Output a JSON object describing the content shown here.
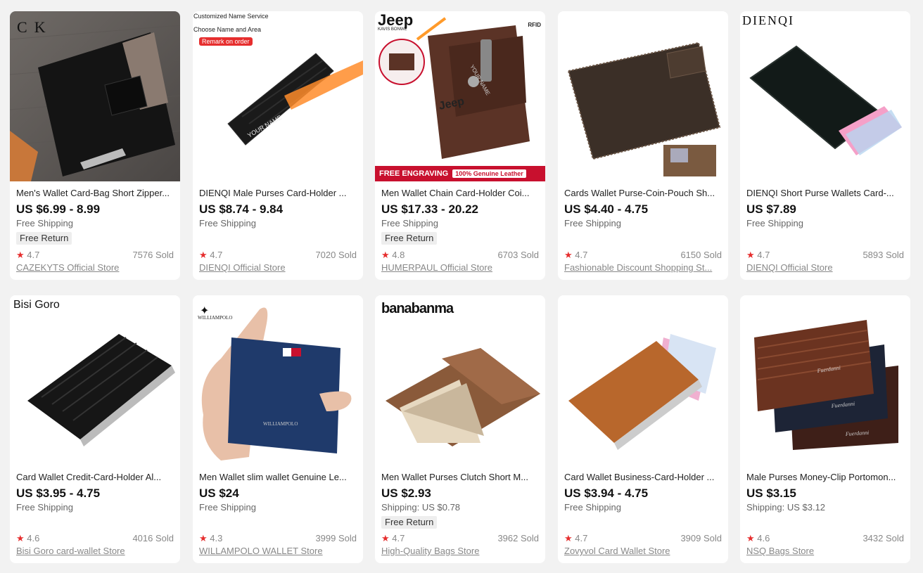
{
  "products": [
    {
      "title": "Men's Wallet Card-Bag Short Zipper...",
      "price": "US $6.99 - 8.99",
      "shipping": "Free Shipping",
      "badge": "Free Return",
      "rating": "4.7",
      "sold": "7576 Sold",
      "store": "CAZEKYTS Official Store",
      "image_text": [
        "C",
        "K"
      ]
    },
    {
      "title": "DIENQI Male Purses Card-Holder ...",
      "price": "US $8.74 - 9.84",
      "shipping": "Free Shipping",
      "badge": "",
      "rating": "4.7",
      "sold": "7020 Sold",
      "store": "DIENQI Official Store",
      "image_text": [
        "Customized Name Service",
        "Choose Name and Area",
        "Remark on order",
        "YOUR NAME"
      ]
    },
    {
      "title": "Men Wallet Chain Card-Holder Coi...",
      "price": "US $17.33 - 20.22",
      "shipping": "Free Shipping",
      "badge": "Free Return",
      "rating": "4.8",
      "sold": "6703 Sold",
      "store": "HUMERPAUL Official Store",
      "image_text": [
        "Jeep",
        "KAVIS BONWE",
        "RFID",
        "FREE ENGRAVING",
        "100% Genuine Leather",
        "YOUR NAME",
        "Jeep"
      ]
    },
    {
      "title": "Cards Wallet Purse-Coin-Pouch Sh...",
      "price": "US $4.40 - 4.75",
      "shipping": "Free Shipping",
      "badge": "",
      "rating": "4.7",
      "sold": "6150 Sold",
      "store": "Fashionable Discount Shopping St...",
      "image_text": []
    },
    {
      "title": "DIENQI Short Purse Wallets Card-...",
      "price": "US $7.89",
      "shipping": "Free Shipping",
      "badge": "",
      "rating": "4.7",
      "sold": "5893 Sold",
      "store": "DIENQI Official Store",
      "image_text": [
        "DIENQI"
      ]
    },
    {
      "title": "Card Wallet Credit-Card-Holder Al...",
      "price": "US $3.95 - 4.75",
      "shipping": "Free Shipping",
      "badge": "",
      "rating": "4.6",
      "sold": "4016 Sold",
      "store": "Bisi Goro card-wallet Store",
      "image_text": [
        "Bisi Goro"
      ]
    },
    {
      "title": "Men Wallet slim wallet Genuine Le...",
      "price": "US $24",
      "shipping": "Free Shipping",
      "badge": "",
      "rating": "4.3",
      "sold": "3999 Sold",
      "store": "WILLAMPOLO WALLET Store",
      "image_text": [
        "WILLIAMPOLO",
        "WILLIAMPOLO"
      ]
    },
    {
      "title": "Men Wallet Purses Clutch Short M...",
      "price": "US $2.93",
      "shipping": "Shipping: US $0.78",
      "badge": "Free Return",
      "rating": "4.7",
      "sold": "3962 Sold",
      "store": "High-Quality Bags Store",
      "image_text": [
        "banabanma"
      ]
    },
    {
      "title": "Card Wallet Business-Card-Holder ...",
      "price": "US $3.94 - 4.75",
      "shipping": "Free Shipping",
      "badge": "",
      "rating": "4.7",
      "sold": "3909 Sold",
      "store": "Zovyvol Card Wallet Store",
      "image_text": []
    },
    {
      "title": "Male Purses Money-Clip Portomon...",
      "price": "US $3.15",
      "shipping": "Shipping: US $3.12",
      "badge": "",
      "rating": "4.6",
      "sold": "3432 Sold",
      "store": "NSQ Bags Store",
      "image_text": [
        "Fuerdanni",
        "Fuerdanni",
        "Fuerdanni"
      ]
    }
  ],
  "icons": {
    "rating": "star-icon"
  },
  "colors": {
    "star": "#e62e2e",
    "banner": "#c8102e",
    "background": "#f2f2f2"
  }
}
